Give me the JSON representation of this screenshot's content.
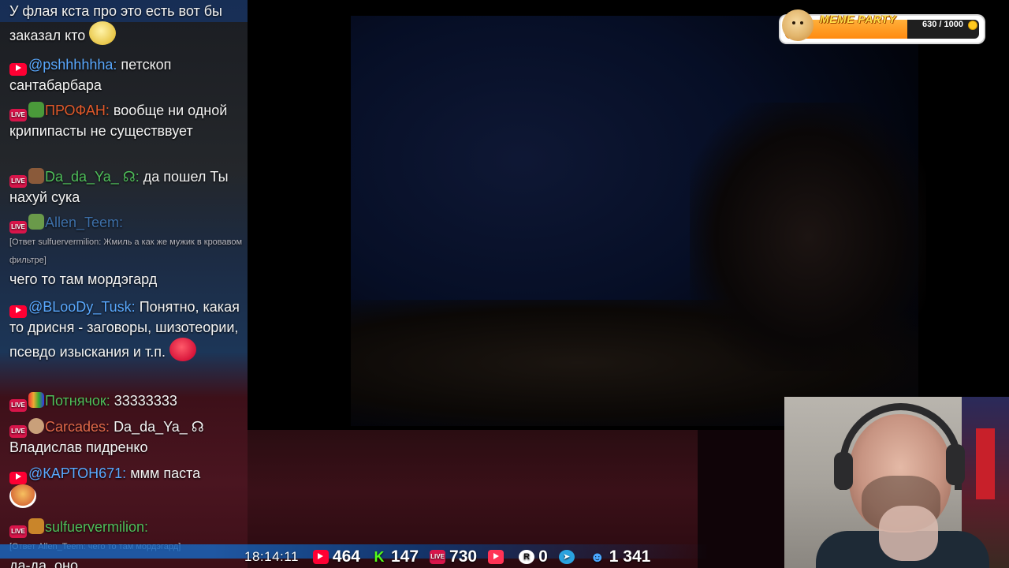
{
  "chat": {
    "messages": [
      {
        "platform": "none",
        "nick": "",
        "text": "У флая кста про это есть вот бы заказал кто",
        "emoji": "smiley-emoji"
      },
      {
        "platform": "youtube",
        "nick": "@pshhhhhha:",
        "nick_color": "#5aa9ff",
        "text": "петскоп сантабарбара"
      },
      {
        "platform": "live",
        "nick": "ПРОФАН:",
        "nick_color": "#e0592a",
        "emblem": "frog-emoji",
        "text": "вообще ни одной крипипасты не существвует"
      },
      {
        "platform": "live",
        "nick": "Da_da_Ya_ ☊:",
        "nick_color": "#4fbf5a",
        "emblem": "hat-emoji",
        "text": "да пошел Ты нахуй сука"
      },
      {
        "platform": "live",
        "nick": "Allen_Teem:",
        "nick_color": "#3d6fa8",
        "emblem": "pepe-emoji",
        "reply": "[Ответ sulfuervermilion: Жмиль а как же мужик в кровавом фильтре]",
        "text": "чего то там мордэгард"
      },
      {
        "platform": "youtube",
        "nick": "@BLooDy_Tusk:",
        "nick_color": "#5aa9ff",
        "text": "Понятно, какая то дрисня - заговоры, шизотеории, псевдо изыскания и т.п.",
        "emoji": "red-blob-emoji"
      },
      {
        "platform": "live",
        "nick": "Потнячок:",
        "nick_color": "#4fbf5a",
        "emblem": "rainbow-emoji",
        "text": "33333333"
      },
      {
        "platform": "live",
        "nick": "Carcades:",
        "nick_color": "#e36a4a",
        "emblem": "egg-emoji",
        "text": "Da_da_Ya_ ☊ Владислав пидренко"
      },
      {
        "platform": "youtube",
        "nick": "@КАРТОН671:",
        "nick_color": "#5aa9ff",
        "text": "ммм паста",
        "emoji": "pasta-emoji"
      },
      {
        "platform": "live",
        "nick": "sulfuervermilion:",
        "nick_color": "#4fbf5a",
        "emblem": "burger-emoji",
        "reply": "[Ответ Allen_Teem: чего то там мордэгард]",
        "text": "да-да, оно"
      }
    ],
    "live_badge": "LIVE"
  },
  "stats": {
    "time": "18:14:11",
    "youtube_viewers": "464",
    "kick_viewers": "147",
    "live_viewers": "730",
    "vk_viewers": "",
    "rumble_viewers": "0",
    "telegram_viewers": "",
    "total_viewers": "1 341",
    "kick_letter": "K",
    "rumble_letter": "R"
  },
  "meme_party": {
    "title": "MEME PARTY",
    "count": "630 / 1000",
    "progress": 0.63
  },
  "colors": {
    "youtube": "#ff0033",
    "live": "#d8154a",
    "kick": "#53fc18",
    "telegram": "#2aa3df",
    "vk_play": "#ff3355",
    "accent_blue": "#1769c4"
  }
}
